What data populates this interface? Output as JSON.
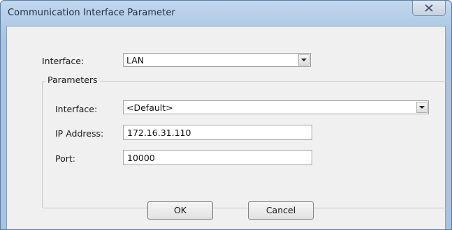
{
  "window": {
    "title": "Communication Interface Parameter",
    "close_icon": "close-icon"
  },
  "interface": {
    "label": "Interface:",
    "selected": "LAN"
  },
  "parameters": {
    "group_label": "Parameters",
    "interface_label": "Interface:",
    "interface_selected": "<Default>",
    "ip_label": "IP Address:",
    "ip_value": "172.16.31.110",
    "port_label": "Port:",
    "port_value": "10000"
  },
  "buttons": {
    "ok": "OK",
    "cancel": "Cancel"
  }
}
